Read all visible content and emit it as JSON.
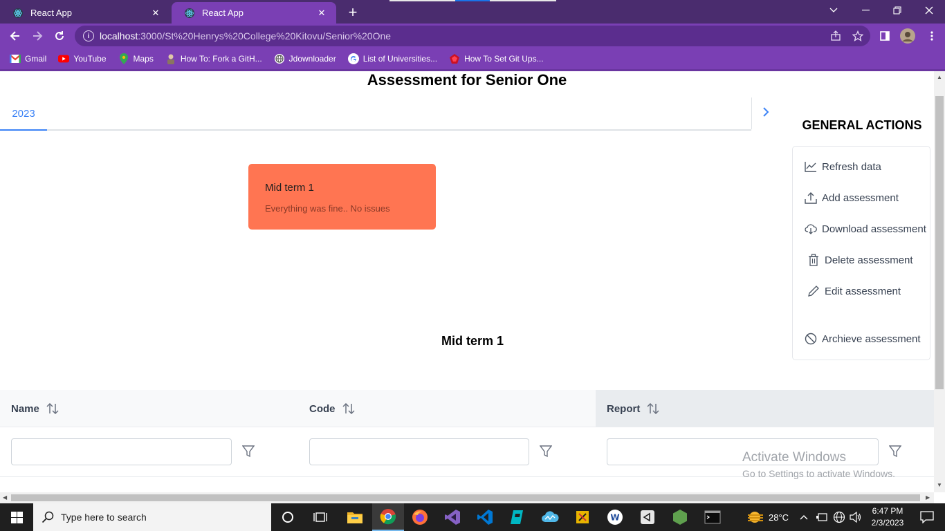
{
  "browser": {
    "tabs": [
      {
        "title": "React App",
        "active": false
      },
      {
        "title": "React App",
        "active": true
      }
    ],
    "url_host": "localhost",
    "url_rest": ":3000/St%20Henrys%20College%20Kitovu/Senior%20One",
    "bookmarks": [
      {
        "label": "Gmail",
        "icon": "gmail-icon"
      },
      {
        "label": "YouTube",
        "icon": "youtube-icon"
      },
      {
        "label": "Maps",
        "icon": "maps-icon"
      },
      {
        "label": "How To: Fork a GitH...",
        "icon": "person-icon"
      },
      {
        "label": "Jdownloader",
        "icon": "globe-icon"
      },
      {
        "label": "List of Universities...",
        "icon": "google-icon"
      },
      {
        "label": "How To Set Git Ups...",
        "icon": "ruby-icon"
      }
    ],
    "colors": {
      "frame": "#4a2c6e",
      "toolbar": "#7a3fb4"
    }
  },
  "page": {
    "title": "Assessment for Senior One",
    "year_tab": "2023",
    "card": {
      "title": "Mid term 1",
      "subtitle": "Everything was fine.. No issues",
      "color": "#ff7552"
    },
    "actions_title": "GENERAL ACTIONS",
    "actions": [
      {
        "label": "Refresh data",
        "icon": "chart-line-icon"
      },
      {
        "label": "Add assessment",
        "icon": "upload-icon"
      },
      {
        "label": "Download assessment",
        "icon": "cloud-download-icon"
      },
      {
        "label": "Delete assessment",
        "icon": "trash-icon"
      },
      {
        "label": "Edit assessment",
        "icon": "pencil-icon"
      },
      {
        "label": "Archieve assessment",
        "icon": "ban-icon"
      }
    ],
    "section_title": "Mid term 1",
    "table": {
      "columns": [
        "Name",
        "Code",
        "Report"
      ]
    }
  },
  "watermark": {
    "line1": "Activate Windows",
    "line2": "Go to Settings to activate Windows."
  },
  "taskbar": {
    "search_placeholder": "Type here to search",
    "weather": "28°C",
    "time": "6:47 PM",
    "date": "2/3/2023"
  }
}
